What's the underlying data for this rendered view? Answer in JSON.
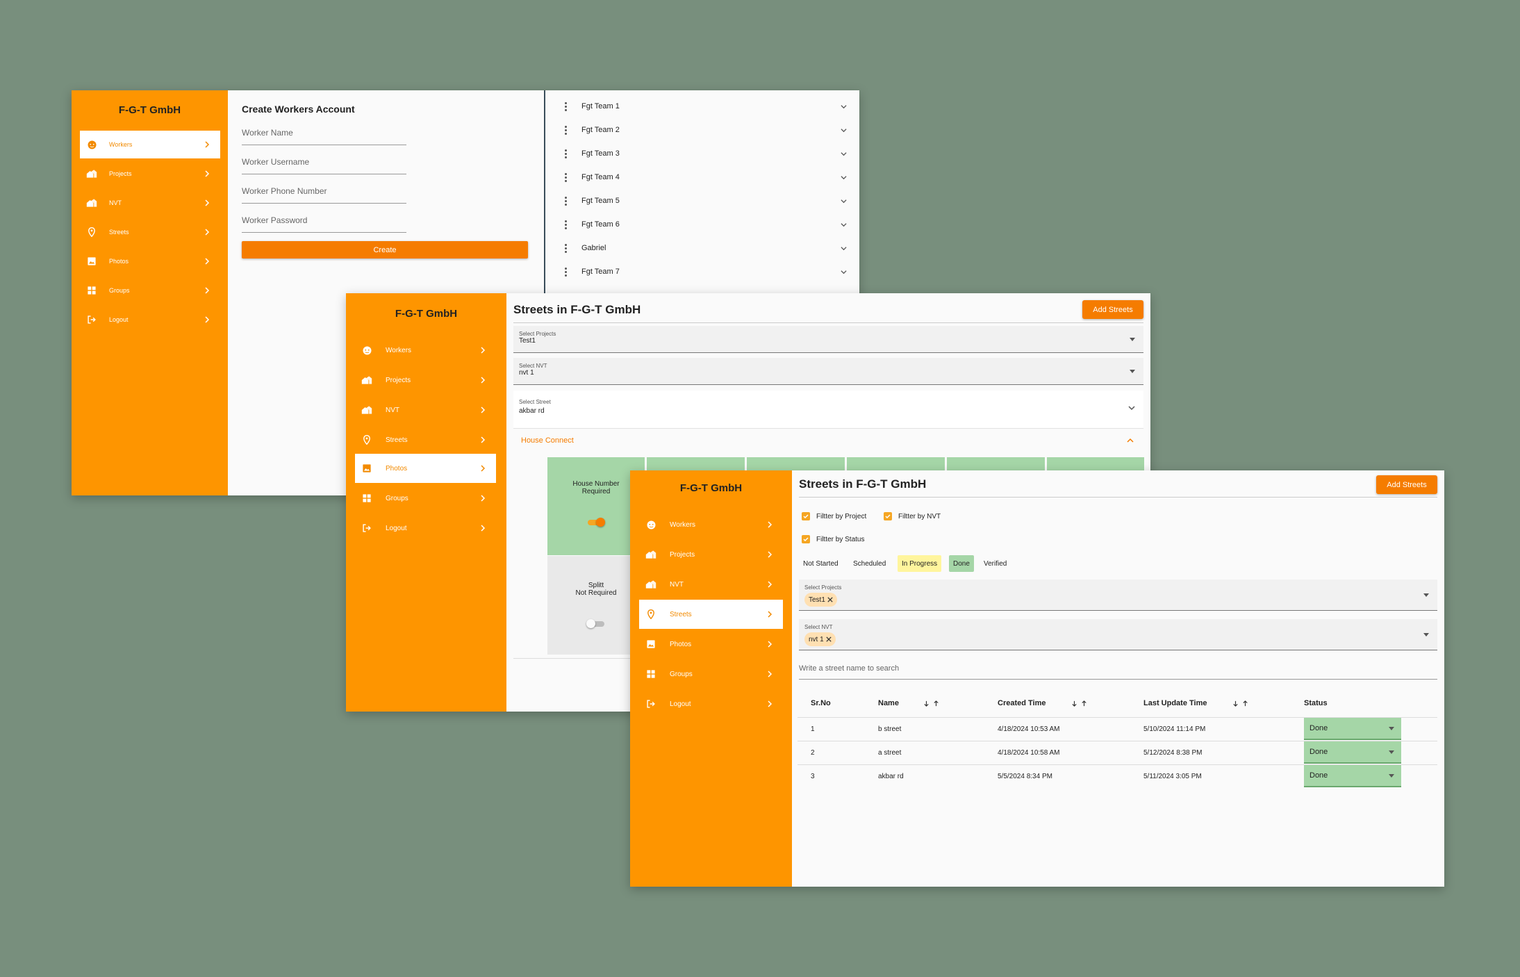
{
  "brand": "F-G-T GmbH",
  "nav": [
    {
      "label": "Workers",
      "icon": "worker-face-icon"
    },
    {
      "label": "Projects",
      "icon": "projects-house-icon"
    },
    {
      "label": "NVT",
      "icon": "nvt-house-icon"
    },
    {
      "label": "Streets",
      "icon": "location-pin-icon"
    },
    {
      "label": "Photos",
      "icon": "photo-icon"
    },
    {
      "label": "Groups",
      "icon": "grid-icon"
    },
    {
      "label": "Logout",
      "icon": "logout-icon"
    }
  ],
  "workers_window": {
    "form_title": "Create Workers Account",
    "fields": [
      "Worker Name",
      "Worker Username",
      "Worker Phone Number",
      "Worker Password"
    ],
    "create_label": "Create",
    "teams": [
      "Fgt Team 1",
      "Fgt Team 2",
      "Fgt Team 3",
      "Fgt Team 4",
      "Fgt Team 5",
      "Fgt Team 6",
      "Gabriel",
      "Fgt Team 7"
    ]
  },
  "photos_window": {
    "title": "Streets in F-G-T GmbH",
    "add_label": "Add Streets",
    "select_projects": {
      "label": "Select Projects",
      "value": "Test1"
    },
    "select_nvt": {
      "label": "Select NVT",
      "value": "nvt 1"
    },
    "select_street": {
      "label": "Select Street",
      "value": "akbar rd"
    },
    "house_connect": "House Connect",
    "house_number": "House Number\nRequired",
    "splitt": "Splitt\nNot Required"
  },
  "streets_window": {
    "title": "Streets in F-G-T GmbH",
    "add_label": "Add Streets",
    "filters": {
      "project": "Filtter by Project",
      "nvt": "Filtter by NVT",
      "status": "Filtter by Status"
    },
    "statuses": [
      {
        "label": "Not Started",
        "color": "#fafafa"
      },
      {
        "label": "Scheduled",
        "color": "#fafafa"
      },
      {
        "label": "In Progress",
        "color": "#fff59d"
      },
      {
        "label": "Done",
        "color": "#a5d6a7"
      },
      {
        "label": "Verified",
        "color": "#fafafa"
      }
    ],
    "select_projects": {
      "label": "Select Projects",
      "chip": "Test1"
    },
    "select_nvt": {
      "label": "Select NVT",
      "chip": "nvt 1"
    },
    "search_placeholder": "Write a street name to search",
    "columns": {
      "srno": "Sr.No",
      "name": "Name",
      "created": "Created Time",
      "updated": "Last Update Time",
      "status": "Status"
    },
    "rows": [
      {
        "srno": "1",
        "name": "b street",
        "created": "4/18/2024 10:53 AM",
        "updated": "5/10/2024 11:14 PM",
        "status": "Done"
      },
      {
        "srno": "2",
        "name": "a street",
        "created": "4/18/2024 10:58 AM",
        "updated": "5/12/2024 8:38 PM",
        "status": "Done"
      },
      {
        "srno": "3",
        "name": "akbar rd",
        "created": "5/5/2024 8:34 PM",
        "updated": "5/11/2024 3:05 PM",
        "status": "Done"
      }
    ]
  },
  "colors": {
    "sidebar": "#fe9500",
    "accent": "#f57c00",
    "background": "#788f7d",
    "done": "#a5d6a7",
    "in_progress": "#fff59d"
  }
}
